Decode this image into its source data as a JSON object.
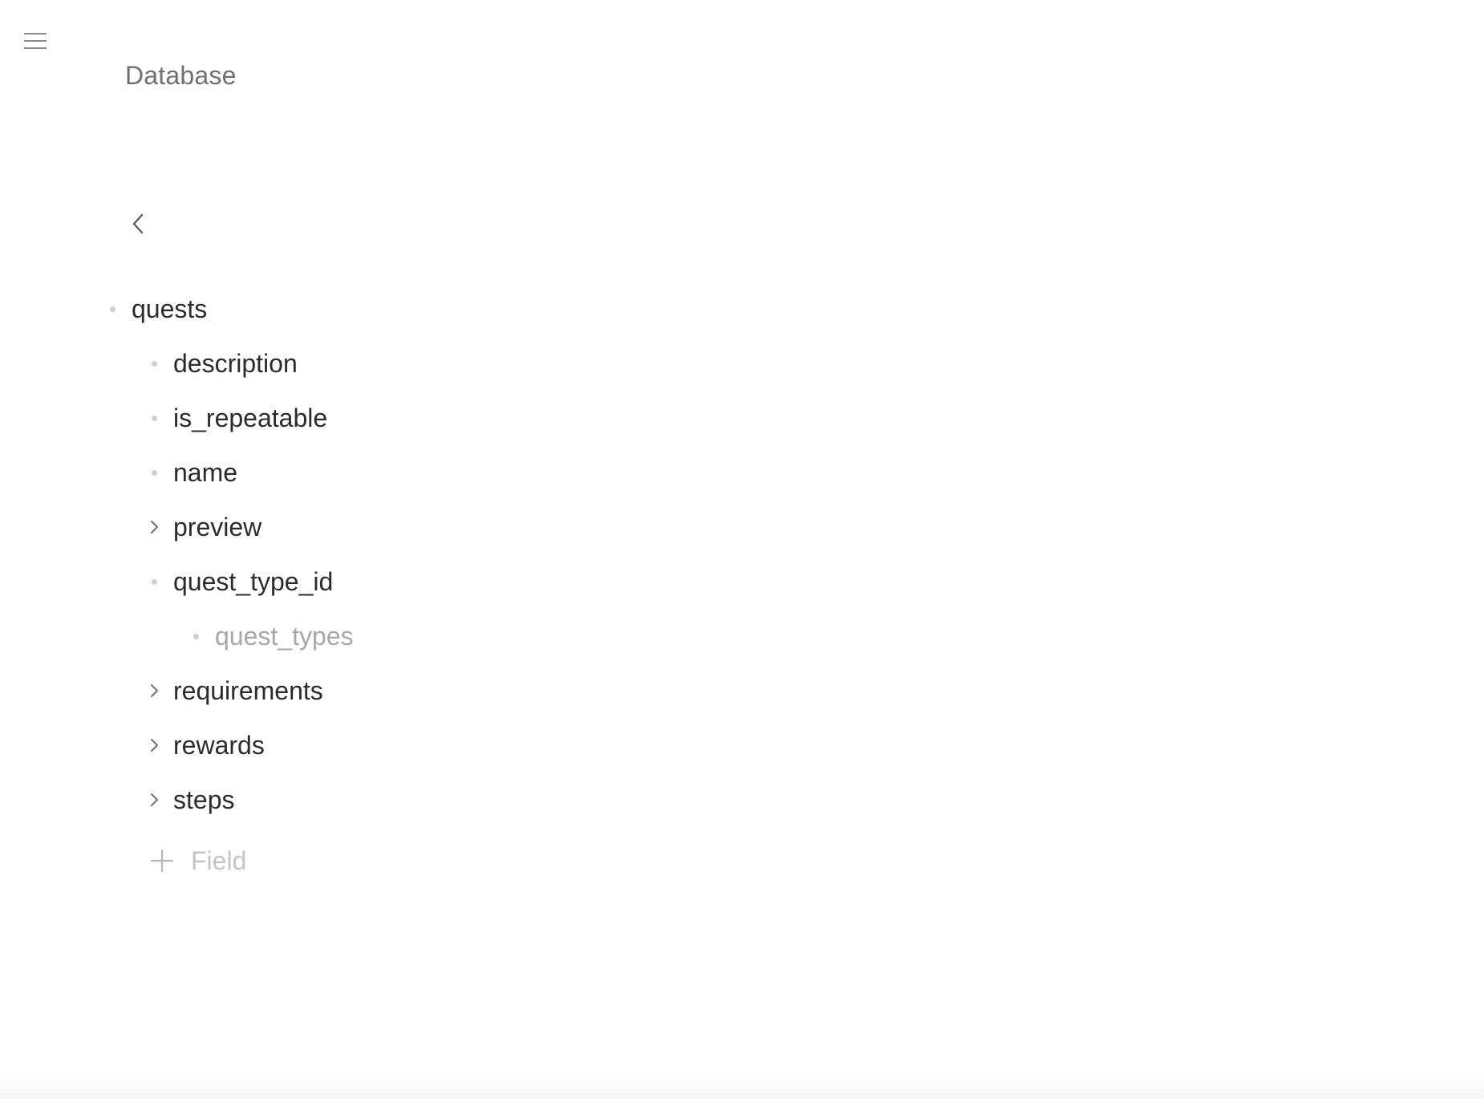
{
  "header": {
    "title": "Database",
    "menu_icon": "hamburger-icon",
    "back_icon": "chevron-left-icon"
  },
  "tree": {
    "root": {
      "label": "quests",
      "icon": "bullet-icon"
    },
    "fields": [
      {
        "label": "description",
        "icon": "bullet-icon"
      },
      {
        "label": "is_repeatable",
        "icon": "bullet-icon"
      },
      {
        "label": "name",
        "icon": "bullet-icon"
      },
      {
        "label": "preview",
        "icon": "chevron-right-icon"
      },
      {
        "label": "quest_type_id",
        "icon": "bullet-icon"
      },
      {
        "label": "quest_types",
        "icon": "bullet-icon",
        "muted": true
      },
      {
        "label": "requirements",
        "icon": "chevron-right-icon"
      },
      {
        "label": "rewards",
        "icon": "chevron-right-icon"
      },
      {
        "label": "steps",
        "icon": "chevron-right-icon"
      }
    ],
    "add_field": {
      "label": "Field",
      "icon": "plus-icon"
    }
  },
  "colors": {
    "text": "#2b2b2f",
    "muted_text": "#a7a7ab",
    "title_text": "#6f6f73",
    "bullet": "#cfcfd2",
    "icon": "#8a8a8e"
  }
}
